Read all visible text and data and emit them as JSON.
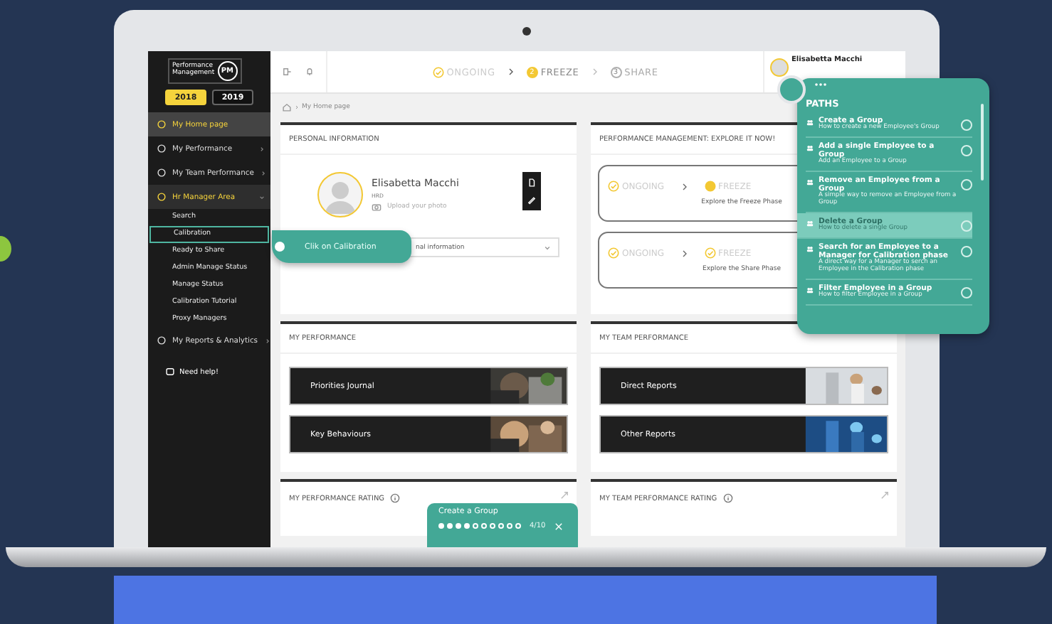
{
  "sidebar": {
    "logo": {
      "line1": "Performance",
      "line2": "Management",
      "badge": "PM"
    },
    "years": [
      {
        "label": "2018",
        "selected": true
      },
      {
        "label": "2019",
        "selected": false
      }
    ],
    "items": [
      {
        "label": "My Home page",
        "selected": true,
        "expanded": false,
        "has_arrow": false
      },
      {
        "label": "My Performance",
        "selected": false,
        "expanded": false,
        "has_arrow": true
      },
      {
        "label": "My Team Performance",
        "selected": false,
        "expanded": false,
        "has_arrow": true
      },
      {
        "label": "Hr Manager Area",
        "selected": false,
        "expanded": true,
        "has_arrow": true,
        "children": [
          {
            "label": "Search",
            "selected": false
          },
          {
            "label": "Calibration",
            "selected": true
          },
          {
            "label": "Ready to Share",
            "selected": false
          },
          {
            "label": "Admin Manage Status",
            "selected": false
          },
          {
            "label": "Manage Status",
            "selected": false
          },
          {
            "label": "Calibration Tutorial",
            "selected": false
          },
          {
            "label": "Proxy Managers",
            "selected": false
          }
        ]
      },
      {
        "label": "My Reports & Analytics",
        "selected": false,
        "expanded": false,
        "has_arrow": true
      }
    ],
    "help": "Need help!"
  },
  "topbar": {
    "steps": [
      {
        "label": "ONGOING",
        "done": true,
        "current": false
      },
      {
        "label": "FREEZE",
        "done": false,
        "current": true,
        "number": "2"
      },
      {
        "label": "SHARE",
        "done": false,
        "current": false,
        "number": "3"
      }
    ],
    "user": "Elisabetta Macchi"
  },
  "breadcrumb": "My Home page",
  "personal": {
    "title": "PERSONAL INFORMATION",
    "name": "Elisabetta Macchi",
    "role": "HRD",
    "upload": "Upload your photo",
    "dropdown": "nal information"
  },
  "explore": {
    "title": "PERFORMANCE MANAGEMENT: EXPLORE IT NOW!",
    "boxes": [
      {
        "steps": [
          {
            "label": "ONGOING",
            "done": true,
            "current": false
          },
          {
            "label": "FREEZE",
            "done": false,
            "current": true
          }
        ],
        "caption": "Explore the Freeze Phase"
      },
      {
        "steps": [
          {
            "label": "ONGOING",
            "done": true,
            "current": false
          },
          {
            "label": "FREEZE",
            "done": true,
            "current": false
          }
        ],
        "caption": "Explore the Share Phase"
      }
    ]
  },
  "my_performance": {
    "title": "MY PERFORMANCE",
    "links": [
      "Priorities Journal",
      "Key Behaviours"
    ]
  },
  "team_performance": {
    "title": "MY TEAM PERFORMANCE",
    "links": [
      "Direct Reports",
      "Other Reports"
    ]
  },
  "ratings": [
    "MY PERFORMANCE RATING",
    "MY TEAM PERFORMANCE RATING"
  ],
  "tooltip": "Clik on Calibration",
  "paths": {
    "title": "PATHS",
    "items": [
      {
        "title": "Create a Group",
        "subtitle": "How to create a new Employee's Group",
        "selected": false
      },
      {
        "title": "Add a single Employee to a Group",
        "subtitle": "Add an Employee to a Group",
        "selected": false
      },
      {
        "title": "Remove an Employee from a Group",
        "subtitle": "A simple way to remove an Employee from a Group",
        "selected": false
      },
      {
        "title": "Delete a Group",
        "subtitle": "How to delete a single Group",
        "selected": true
      },
      {
        "title": "Search for an Employee to a Manager for Calibration phase",
        "subtitle": "A direct way for a Manager to serch an Employee in the Calibration phase",
        "selected": false
      },
      {
        "title": "Filter Employee in a Group",
        "subtitle": "How to filter Employee in a Group",
        "selected": false
      }
    ]
  },
  "tour": {
    "title": "Create a Group",
    "dots": [
      {
        "filled": true
      },
      {
        "filled": true
      },
      {
        "filled": true
      },
      {
        "filled": true
      },
      {
        "filled": false
      },
      {
        "filled": false
      },
      {
        "filled": false
      },
      {
        "filled": false
      },
      {
        "filled": false
      },
      {
        "filled": false
      }
    ],
    "counter": "4/10"
  }
}
